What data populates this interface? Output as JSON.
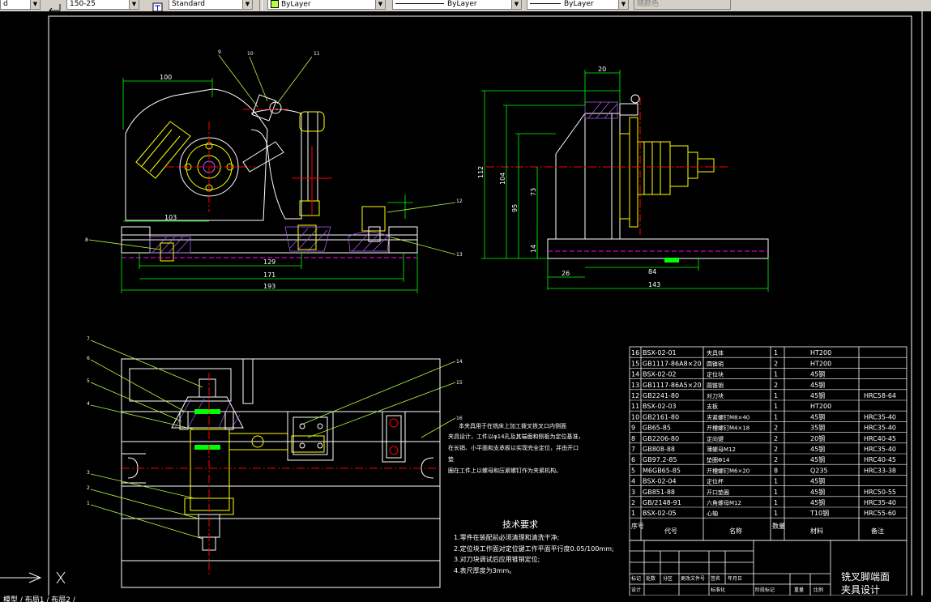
{
  "toolbar": {
    "dimstyle_value": "150-25",
    "textstyle_value": "Standard",
    "layer_value": "ByLayer",
    "linetype_value": "ByLayer",
    "lineweight_value": "ByLayer",
    "plotstyle_value": "随颜色",
    "left_clip": "d"
  },
  "drawing": {
    "front_dims": [
      "100",
      "103",
      "129",
      "171",
      "193"
    ],
    "side_dims": [
      "20",
      "112",
      "104",
      "95",
      "73",
      "14",
      "26",
      "84",
      "143"
    ],
    "front_balloons": [
      "9",
      "10",
      "11",
      "12",
      "13",
      "8"
    ],
    "plan_balloons": [
      "7",
      "6",
      "5",
      "4",
      "3",
      "2",
      "1",
      "14",
      "15",
      "16"
    ],
    "description": [
      "本夹具用于在铣床上加工拨叉铁叉口内侧面",
      "夹具设计，工件以φ14孔及其端面和侧板为定位基准，",
      "在长销、小平面和支承板以实现完全定位，并由开口",
      "垫",
      "圈在工件上以螺母和压紧螺钉作为夹紧机构。"
    ],
    "tech_title": "技术要求",
    "tech_reqs": [
      "1.零件在装配前必须清理和清洗干净;",
      "2.定位块工作面对定位键工作平面平行度0.05/100mm;",
      "3.对刀块调试后应用锥销定位;",
      "4.表尺厚度为3mm。"
    ]
  },
  "bom": {
    "rows": [
      {
        "no": "16",
        "code": "BSX-02-01",
        "name": "夹具体",
        "qty": "1",
        "mat": "HT200",
        "note": ""
      },
      {
        "no": "15",
        "code": "GB1117-86A8×20",
        "name": "圆锥销",
        "qty": "2",
        "mat": "HT200",
        "note": ""
      },
      {
        "no": "14",
        "code": "BSX-02-02",
        "name": "定位块",
        "qty": "1",
        "mat": "45钢",
        "note": ""
      },
      {
        "no": "13",
        "code": "GB1117-86A5×20",
        "name": "圆锥销",
        "qty": "2",
        "mat": "45钢",
        "note": ""
      },
      {
        "no": "12",
        "code": "GB2241-80",
        "name": "对刀块",
        "qty": "1",
        "mat": "45钢",
        "note": "HRC58-64"
      },
      {
        "no": "11",
        "code": "BSX-02-03",
        "name": "支板",
        "qty": "1",
        "mat": "HT200",
        "note": ""
      },
      {
        "no": "10",
        "code": "GB2161-80",
        "name": "夹紧螺钉M8×40",
        "qty": "1",
        "mat": "45钢",
        "note": "HRC35-40"
      },
      {
        "no": "9",
        "code": "GB65-85",
        "name": "开槽螺钉M4×18",
        "qty": "2",
        "mat": "35钢",
        "note": "HRC35-40"
      },
      {
        "no": "8",
        "code": "GB2206-80",
        "name": "定向键",
        "qty": "2",
        "mat": "20钢",
        "note": "HRC40-45"
      },
      {
        "no": "7",
        "code": "GB808-88",
        "name": "薄螺母M12",
        "qty": "2",
        "mat": "45钢",
        "note": "HRC35-40"
      },
      {
        "no": "6",
        "code": "GB97.2-85",
        "name": "垫圈Φ14",
        "qty": "2",
        "mat": "45钢",
        "note": "HRC40-45"
      },
      {
        "no": "5",
        "code": "M6GB65-85",
        "name": "开槽螺钉M6×20",
        "qty": "8",
        "mat": "Q235",
        "note": "HRC33-38"
      },
      {
        "no": "4",
        "code": "BSX-02-04",
        "name": "定位杯",
        "qty": "1",
        "mat": "45钢",
        "note": ""
      },
      {
        "no": "3",
        "code": "GB851-88",
        "name": "开口垫圈",
        "qty": "1",
        "mat": "45钢",
        "note": "HRC50-55"
      },
      {
        "no": "2",
        "code": "GB/2148-91",
        "name": "六角螺母M12",
        "qty": "1",
        "mat": "45钢",
        "note": "HRC35-40"
      },
      {
        "no": "1",
        "code": "BSX-02-05",
        "name": "心轴",
        "qty": "1",
        "mat": "T10钢",
        "note": "HRC55-60"
      }
    ],
    "header": {
      "no": "序号",
      "code": "代号",
      "name": "名称",
      "qty": "数量",
      "mat": "材料",
      "note": "备注"
    }
  },
  "title_block": {
    "title_line1": "铣叉脚端面",
    "title_line2": "夹具设计",
    "row1": [
      "标记",
      "处数",
      "分区",
      "更改文件号",
      "签名",
      "年月日"
    ],
    "row2": [
      "设计",
      "",
      "",
      "标准化"
    ],
    "row3": [
      "阶段标记",
      "重量",
      "比例"
    ]
  },
  "status": {
    "text": "模型 / 布局1 / 布局2 /"
  },
  "colors": {
    "background": "#000000",
    "line_white": "#ffffff",
    "dim_green": "#00ff00",
    "leader_yellowgreen": "#b4ff3c",
    "part_yellow": "#ffff00",
    "center_red": "#ff0000",
    "dash_magenta": "#ff00ff",
    "hatch_purple": "#b060ff",
    "shaft_green": "#00ff00"
  }
}
